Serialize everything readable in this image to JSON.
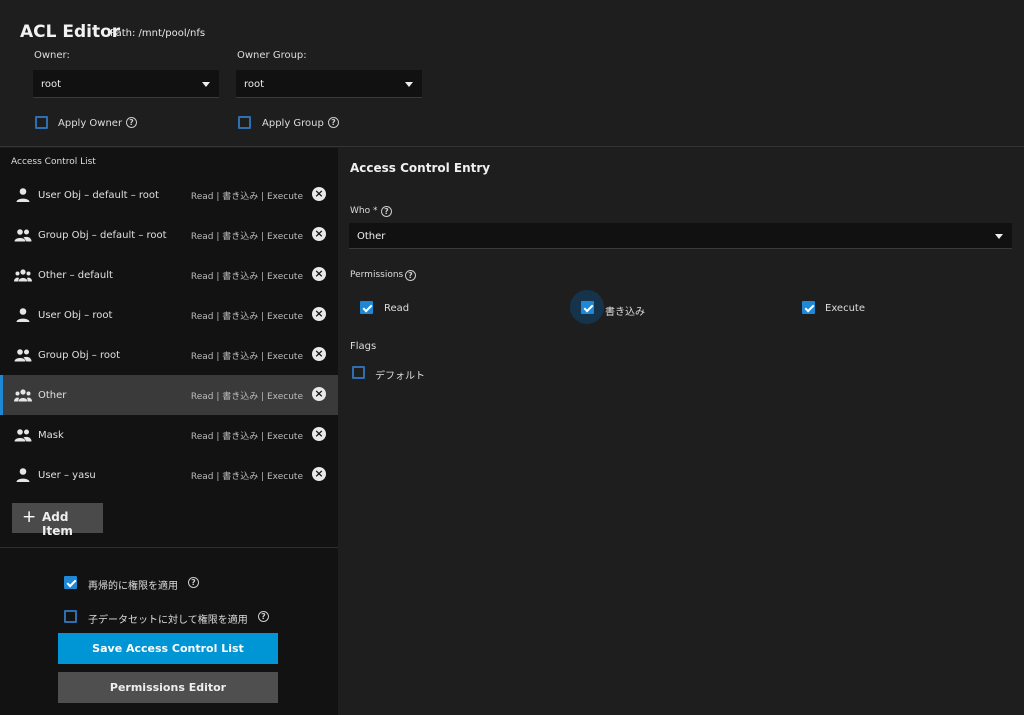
{
  "header": {
    "title": "ACL Editor",
    "path": "Path:  /mnt/pool/nfs",
    "owner_label": "Owner:",
    "owner_value": "root",
    "owner_group_label": "Owner Group:",
    "owner_group_value": "root",
    "apply_owner": "Apply Owner",
    "apply_group": "Apply Group"
  },
  "acl_list": {
    "heading": "Access Control List",
    "items": [
      {
        "name": "User Obj – default – root",
        "perms": "Read | 書き込み | Execute",
        "icon": "user-icon"
      },
      {
        "name": "Group Obj – default – root",
        "perms": "Read | 書き込み | Execute",
        "icon": "group-icon"
      },
      {
        "name": "Other – default",
        "perms": "Read | 書き込み | Execute",
        "icon": "other-icon"
      },
      {
        "name": "User Obj – root",
        "perms": "Read | 書き込み | Execute",
        "icon": "user-icon"
      },
      {
        "name": "Group Obj – root",
        "perms": "Read | 書き込み | Execute",
        "icon": "group-icon"
      },
      {
        "name": "Other",
        "perms": "Read | 書き込み | Execute",
        "icon": "other-icon",
        "selected": true
      },
      {
        "name": "Mask",
        "perms": "Read | 書き込み | Execute",
        "icon": "group-icon"
      },
      {
        "name": "User – yasu",
        "perms": "Read | 書き込み | Execute",
        "icon": "user-icon"
      }
    ],
    "add_item": "Add Item"
  },
  "footer": {
    "recursive": "再帰的に権限を適用",
    "recursive_checked": true,
    "child_datasets": "子データセットに対して権限を適用",
    "child_checked": false,
    "save": "Save Access Control List",
    "perm_editor": "Permissions Editor"
  },
  "entry": {
    "title": "Access Control Entry",
    "who_label": "Who *",
    "who_value": "Other",
    "permissions_label": "Permissions",
    "perm_read": "Read",
    "perm_write": "書き込み",
    "perm_execute": "Execute",
    "flags_label": "Flags",
    "flag_default": "デフォルト"
  },
  "colors": {
    "accent": "#0095d5",
    "checkbox": "#1e88d6"
  }
}
